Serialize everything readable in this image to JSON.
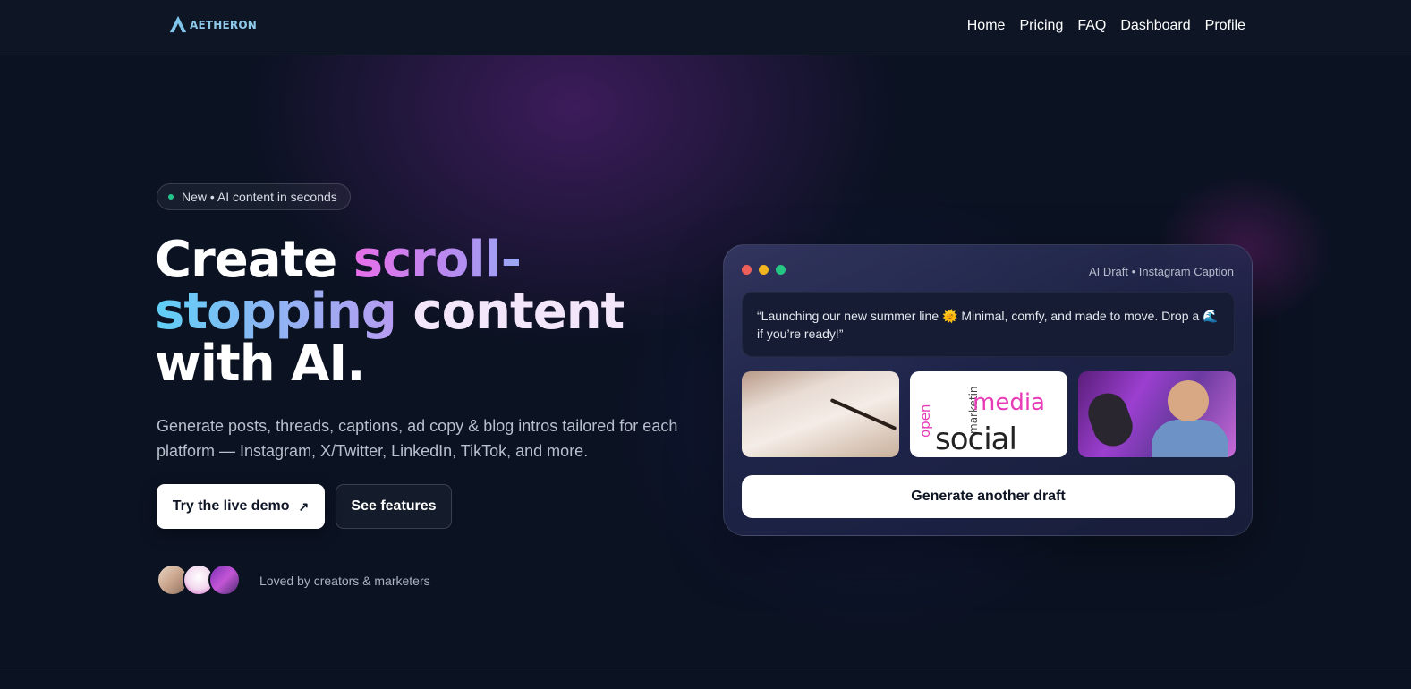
{
  "header": {
    "logo_text": "AETHERON",
    "nav": [
      "Home",
      "Pricing",
      "FAQ",
      "Dashboard",
      "Profile"
    ]
  },
  "hero": {
    "badge": "New • AI content in seconds",
    "headline": {
      "part1": "Create ",
      "part2": "scroll-",
      "part3": "stopping",
      "part4": " content",
      "part5": "with AI."
    },
    "subtitle": "Generate posts, threads, captions, ad copy & blog intros tailored for each platform — Instagram, X/Twitter, LinkedIn, TikTok, and more.",
    "primary_button": "Try the live demo",
    "primary_button_icon": "↗",
    "secondary_button": "See features",
    "social_proof": "Loved by creators & marketers"
  },
  "card": {
    "label": "AI Draft • Instagram Caption",
    "caption": "“Launching our new summer line 🌞 Minimal, comfy, and made to move. Drop a 🌊 if you’re ready!”",
    "thumb_words": {
      "media": "media",
      "social": "social",
      "open": "open",
      "marketing": "marketin"
    },
    "generate_button": "Generate another draft"
  },
  "colors": {
    "accent_pink": "#e86ee8",
    "accent_blue": "#5fd0f5",
    "status_green": "#22c58b"
  }
}
